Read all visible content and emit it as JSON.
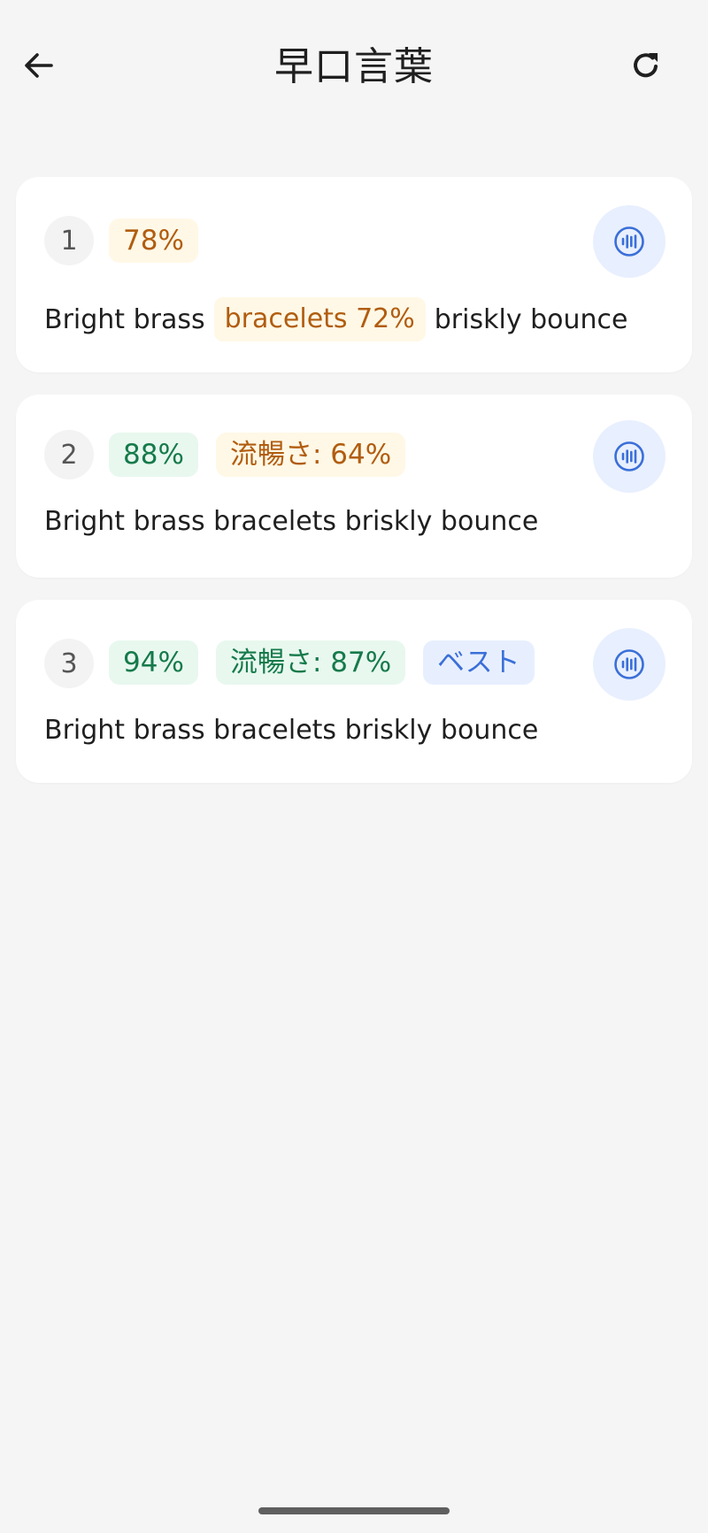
{
  "header": {
    "title": "早口言葉"
  },
  "results": [
    {
      "number": "1",
      "score": "78%",
      "phrase_before": "Bright brass",
      "phrase_highlight": "bracelets 72%",
      "phrase_after": "briskly bounce"
    },
    {
      "number": "2",
      "score": "88%",
      "fluency": "流暢さ: 64%",
      "phrase": "Bright brass bracelets briskly bounce"
    },
    {
      "number": "3",
      "score": "94%",
      "fluency": "流暢さ: 87%",
      "badge": "ベスト",
      "phrase": "Bright brass bracelets briskly bounce"
    }
  ],
  "colors": {
    "background": "#f5f5f5",
    "card": "#ffffff",
    "amber_text": "#b15d10",
    "amber_bg": "#fff8e6",
    "green_text": "#157a4a",
    "green_bg": "#e8f8ef",
    "blue_text": "#3a6fd8",
    "blue_bg": "#e7efff"
  },
  "icons": {
    "back": "arrow-left-icon",
    "refresh": "refresh-icon",
    "play": "audio-wave-icon"
  }
}
